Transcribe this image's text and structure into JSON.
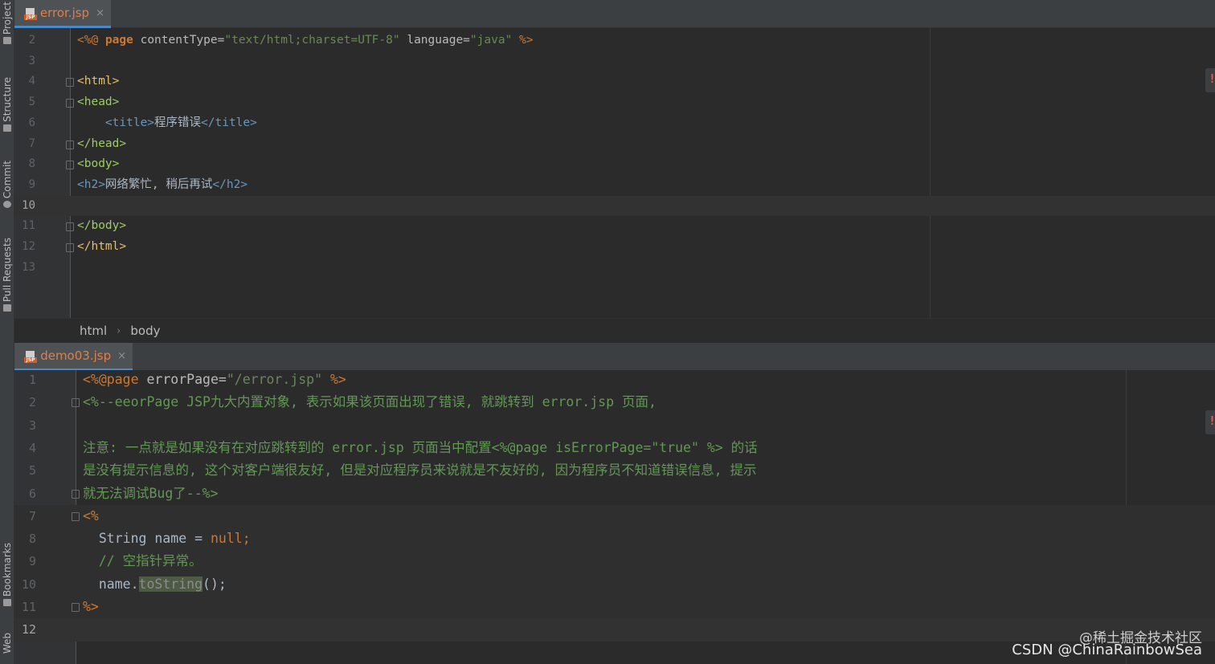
{
  "sidebar": {
    "items": [
      {
        "label": "Project"
      },
      {
        "label": "Structure"
      },
      {
        "label": "Commit"
      },
      {
        "label": "Pull Requests"
      },
      {
        "label": "Bookmarks"
      },
      {
        "label": "Web"
      }
    ]
  },
  "top_editor": {
    "tab": {
      "file_type": "JSP",
      "name": "error.jsp",
      "close": "×"
    },
    "current_line": 10,
    "lines": [
      {
        "num": "2"
      },
      {
        "num": "3"
      },
      {
        "num": "4"
      },
      {
        "num": "5"
      },
      {
        "num": "6"
      },
      {
        "num": "7"
      },
      {
        "num": "8"
      },
      {
        "num": "9"
      },
      {
        "num": "10"
      },
      {
        "num": "11"
      },
      {
        "num": "12"
      },
      {
        "num": "13"
      }
    ],
    "code": {
      "l2": [
        "<%@",
        "page",
        "contentType=",
        "\"text/html;charset=UTF-8\"",
        "language=",
        "\"java\"",
        "%>"
      ],
      "l4": "<html>",
      "l5": "<head>",
      "l6": [
        "<title>",
        "程序错误",
        "</title>"
      ],
      "l7": "</head>",
      "l8": "<body>",
      "l9": [
        "<h2>",
        "网络繁忙, 稍后再试",
        "</h2>"
      ],
      "l11": "</body>",
      "l12": "</html>"
    }
  },
  "breadcrumb": {
    "items": [
      "html",
      "body"
    ],
    "separator": "›"
  },
  "bottom_editor": {
    "tab": {
      "file_type": "JSP",
      "name": "demo03.jsp",
      "close": "×"
    },
    "current_line": 12,
    "lines": [
      {
        "num": "1"
      },
      {
        "num": "2"
      },
      {
        "num": "3"
      },
      {
        "num": "4"
      },
      {
        "num": "5"
      },
      {
        "num": "6"
      },
      {
        "num": "7"
      },
      {
        "num": "8"
      },
      {
        "num": "9"
      },
      {
        "num": "10"
      },
      {
        "num": "11"
      },
      {
        "num": "12"
      }
    ],
    "code": {
      "l1": [
        "<%@page",
        "errorPage=",
        "\"/error.jsp\"",
        "%>"
      ],
      "l2": "<%--eeorPage JSP九大内置对象, 表示如果该页面出现了错误, 就跳转到 error.jsp 页面,",
      "l4": "注意: 一点就是如果没有在对应跳转到的 error.jsp 页面当中配置<%@page isErrorPage=\"true\" %> 的话",
      "l5": "是没有提示信息的, 这个对客户端很友好, 但是对应程序员来说就是不友好的, 因为程序员不知道错误信息, 提示",
      "l6": "就无法调试Bug了--%>",
      "l7": "<%",
      "l8": [
        "String name = ",
        "null",
        ";"
      ],
      "l9": "// 空指针异常。",
      "l10": [
        "name.",
        "toString",
        "();"
      ],
      "l11": "%>"
    }
  },
  "watermark": {
    "line1": "@稀土掘金技术社区",
    "line2": "CSDN @ChinaRainbowSea"
  },
  "colors": {
    "background": "#2b2b2b",
    "tag": "#e8bf6a",
    "string": "#6a8759",
    "keyword": "#cc7832",
    "comment": "#629755",
    "tab_accent": "#4a88c7"
  }
}
